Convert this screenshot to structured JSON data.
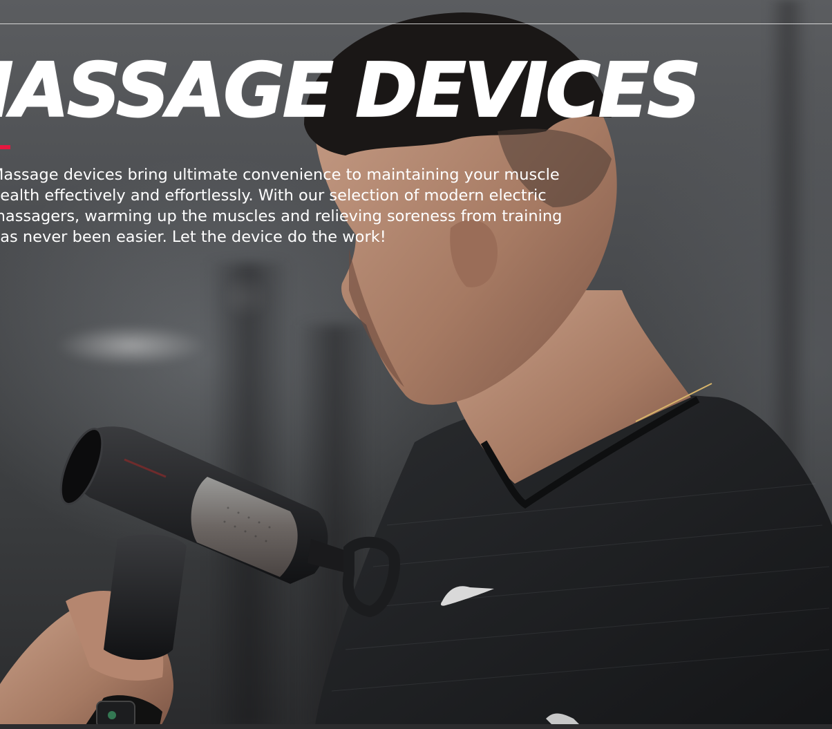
{
  "hero": {
    "heading": "MASSAGE DEVICES",
    "description": "Massage devices bring ultimate convenience to maintaining your muscle\nhealth effectively and effortlessly. With our selection of modern electric\nmassagers, warming up the muscles and relieving soreness from training\nhas never been easier. Let the device do the work!",
    "accent_color": "#e5173f",
    "text_color": "#ffffff"
  },
  "photo": {
    "subject": "man-using-massage-gun-icon",
    "device_brand_text": "",
    "logo": "nike-swoosh-icon"
  }
}
